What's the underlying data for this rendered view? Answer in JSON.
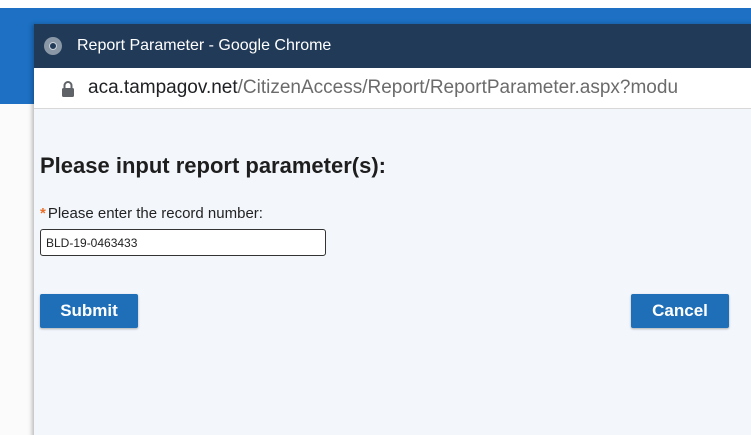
{
  "window": {
    "title": "Report Parameter - Google Chrome"
  },
  "address_bar": {
    "url_host": "aca.tampagov.net",
    "url_path": "/CitizenAccess/Report/ReportParameter.aspx?modu"
  },
  "form": {
    "heading": "Please input report parameter(s):",
    "required_mark": "*",
    "record_label": "Please enter the record number:",
    "record_value": "BLD-19-0463433",
    "submit_label": "Submit",
    "cancel_label": "Cancel"
  },
  "colors": {
    "page_background_blue": "#1d70c4",
    "titlebar": "#213a57",
    "button": "#1e6fb8",
    "required_mark": "#e8702a",
    "content_background": "#f3f7fc"
  },
  "icons": {
    "browser": "chrome-icon",
    "security": "lock-icon"
  }
}
